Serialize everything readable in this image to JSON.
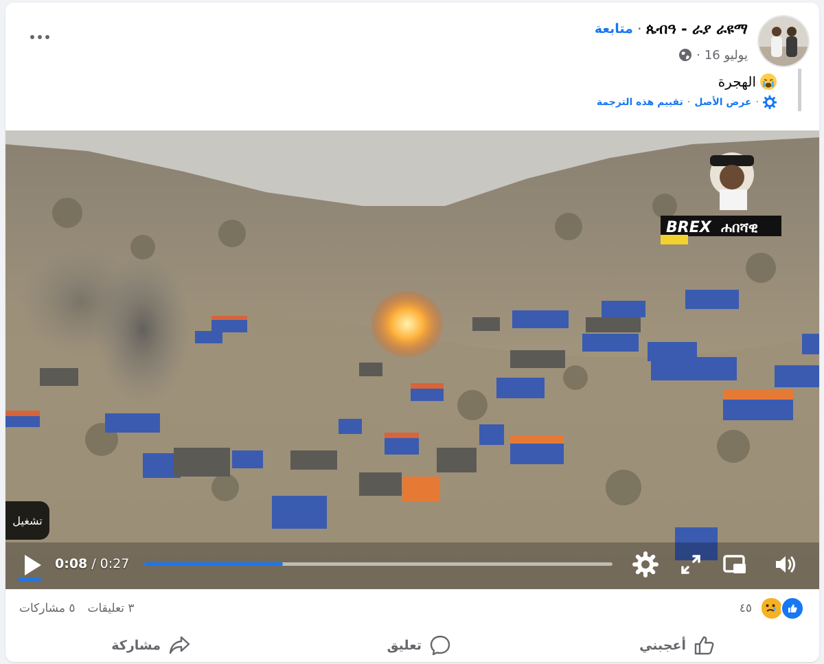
{
  "post": {
    "author_name": "ጴብዓ - ራያ ራዩማ",
    "separator": "·",
    "follow_label": "متابعة",
    "date": "16 يوليو",
    "audience_icon": "globe-icon",
    "text": "الهجرة",
    "text_emoji": "loudly-crying-face-emoji",
    "translation": {
      "see_original": "عرض الأصل",
      "rate_translation": "تقييم هذه الترجمة",
      "icon": "gear-icon"
    },
    "more_icon": "more-options-icon"
  },
  "video": {
    "overlay_label": "تشغيل",
    "watermark_logo": "BREX",
    "watermark_text": "ሐበሻዊ",
    "current_time": "0:08",
    "time_separator": "/",
    "duration": "0:27",
    "progress_fraction": 0.2963,
    "icons": [
      "play-icon",
      "settings-icon",
      "fullscreen-icon",
      "picture-in-picture-icon",
      "volume-icon"
    ]
  },
  "stats": {
    "reaction_count": "٤٥",
    "reaction_icons": [
      "like-reaction-icon",
      "sad-reaction-icon"
    ],
    "comments": "٣ تعليقات",
    "shares": "٥ مشاركات"
  },
  "actions": {
    "like_label": "أعجبني",
    "comment_label": "تعليق",
    "share_label": "مشاركة"
  },
  "colors": {
    "accent": "#1877f2",
    "secondary_text": "#65676b",
    "background": "#f0f2f5"
  }
}
